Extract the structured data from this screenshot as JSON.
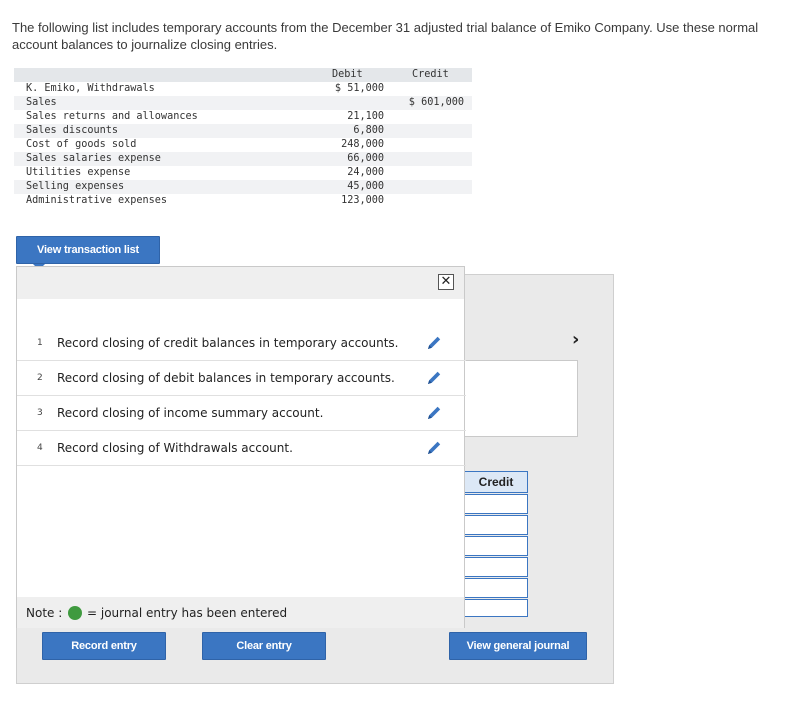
{
  "intro": "The following list includes temporary accounts from the December 31 adjusted trial balance of Emiko Company. Use these normal account balances to journalize closing entries.",
  "trial_balance": {
    "debit_header": "Debit",
    "credit_header": "Credit",
    "rows": [
      {
        "account": "K. Emiko, Withdrawals",
        "debit": "$ 51,000",
        "credit": ""
      },
      {
        "account": "Sales",
        "debit": "",
        "credit": "$ 601,000"
      },
      {
        "account": "Sales returns and allowances",
        "debit": "21,100",
        "credit": ""
      },
      {
        "account": "Sales discounts",
        "debit": "6,800",
        "credit": ""
      },
      {
        "account": "Cost of goods sold",
        "debit": "248,000",
        "credit": ""
      },
      {
        "account": "Sales salaries expense",
        "debit": "66,000",
        "credit": ""
      },
      {
        "account": "Utilities expense",
        "debit": "24,000",
        "credit": ""
      },
      {
        "account": "Selling expenses",
        "debit": "45,000",
        "credit": ""
      },
      {
        "account": "Administrative expenses",
        "debit": "123,000",
        "credit": ""
      }
    ]
  },
  "buttons": {
    "view_transaction_list": "View transaction list",
    "record_entry": "Record entry",
    "clear_entry": "Clear entry",
    "view_general_journal": "View general journal"
  },
  "popup": {
    "close_symbol": "✕",
    "tasks": [
      {
        "num": "1",
        "text": "Record closing of credit balances in temporary accounts."
      },
      {
        "num": "2",
        "text": "Record closing of debit balances in temporary accounts."
      },
      {
        "num": "3",
        "text": "Record closing of income summary account."
      },
      {
        "num": "4",
        "text": "Record closing of Withdrawals account."
      }
    ],
    "note_label": "Note :",
    "note_text": "= journal entry has been entered"
  },
  "journal": {
    "credit_header": "Credit",
    "next_symbol": "›"
  },
  "colors": {
    "button_blue": "#3b76c2",
    "entered_green": "#3f9a3f"
  }
}
